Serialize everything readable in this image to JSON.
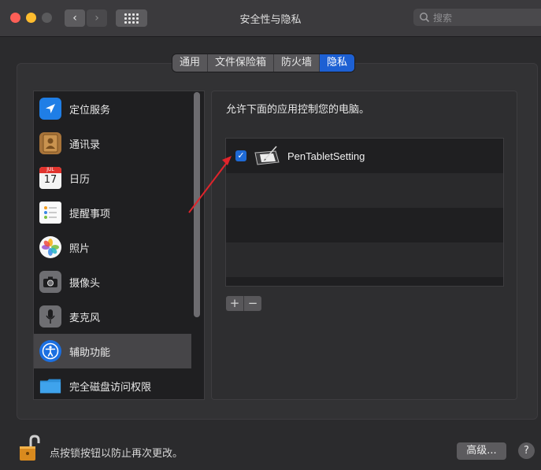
{
  "window": {
    "title": "安全性与隐私",
    "search_placeholder": "搜索"
  },
  "tabs": [
    {
      "label": "通用",
      "active": false
    },
    {
      "label": "文件保险箱",
      "active": false
    },
    {
      "label": "防火墙",
      "active": false
    },
    {
      "label": "隐私",
      "active": true
    }
  ],
  "sidebar": {
    "items": [
      {
        "label": "定位服务",
        "icon": "location-icon",
        "selected": false
      },
      {
        "label": "通讯录",
        "icon": "contacts-icon",
        "selected": false
      },
      {
        "label": "日历",
        "icon": "calendar-icon",
        "selected": false
      },
      {
        "label": "提醒事项",
        "icon": "reminders-icon",
        "selected": false
      },
      {
        "label": "照片",
        "icon": "photos-icon",
        "selected": false
      },
      {
        "label": "摄像头",
        "icon": "camera-icon",
        "selected": false
      },
      {
        "label": "麦克风",
        "icon": "microphone-icon",
        "selected": false
      },
      {
        "label": "辅助功能",
        "icon": "accessibility-icon",
        "selected": true
      },
      {
        "label": "完全磁盘访问权限",
        "icon": "folder-icon",
        "selected": false
      }
    ],
    "calendar_icon": {
      "month": "JUL",
      "day": "17"
    }
  },
  "main": {
    "description": "允许下面的应用控制您的电脑。",
    "apps": [
      {
        "name": "PenTabletSetting",
        "checked": true,
        "icon": "pen-tablet-icon"
      }
    ],
    "add_label": "+",
    "remove_label": "−"
  },
  "footer": {
    "lock_text": "点按锁按钮以防止再次更改。",
    "advanced_label": "高级...",
    "help_label": "?"
  },
  "colors": {
    "accent": "#1d60d3",
    "annotation_arrow": "#e0242b"
  }
}
